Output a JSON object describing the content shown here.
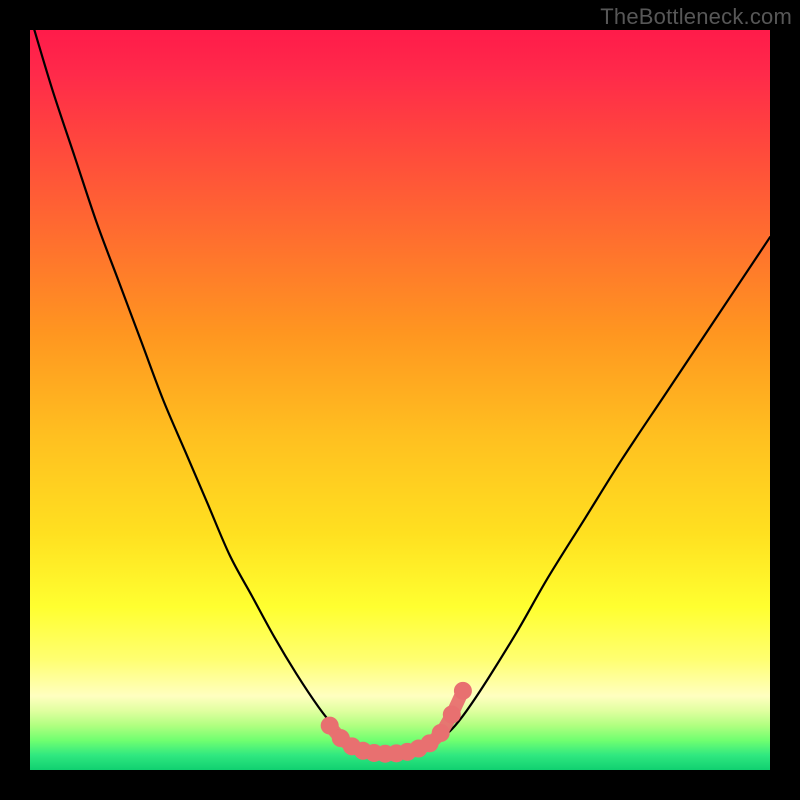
{
  "watermark": "TheBottleneck.com",
  "colors": {
    "frame": "#000000",
    "curve_stroke": "#000000",
    "marker_fill": "#e87070",
    "marker_stroke": "#c85050",
    "gradient_top": "#ff1b4a",
    "gradient_bottom": "#10d070"
  },
  "chart_data": {
    "type": "line",
    "title": "",
    "xlabel": "",
    "ylabel": "",
    "xlim": [
      0,
      100
    ],
    "ylim": [
      0,
      100
    ],
    "note": "Axes are unlabeled in source; values are relative percentages of plot width/height, read from pixel positions.",
    "series": [
      {
        "name": "curve",
        "x": [
          0,
          3,
          6,
          9,
          12,
          15,
          18,
          21,
          24,
          27,
          30,
          33,
          36,
          39,
          41,
          43,
          45,
          47,
          49,
          51,
          53,
          55,
          57,
          59,
          62,
          66,
          70,
          75,
          80,
          86,
          92,
          100
        ],
        "y": [
          102,
          92,
          83,
          74,
          66,
          58,
          50,
          43,
          36,
          29,
          23.5,
          18,
          13,
          8.5,
          6,
          4.2,
          3,
          2.4,
          2.2,
          2.3,
          2.8,
          3.8,
          5.5,
          8,
          12.5,
          19,
          26,
          34,
          42,
          51,
          60,
          72
        ]
      }
    ],
    "markers": {
      "name": "flat-bottom-highlight",
      "x": [
        40.5,
        42,
        43.5,
        45,
        46.5,
        48,
        49.5,
        51,
        52.5,
        54,
        55.5,
        57,
        58.5
      ],
      "y": [
        6.0,
        4.3,
        3.2,
        2.6,
        2.3,
        2.2,
        2.25,
        2.45,
        2.9,
        3.6,
        5.0,
        7.5,
        10.7
      ]
    }
  }
}
